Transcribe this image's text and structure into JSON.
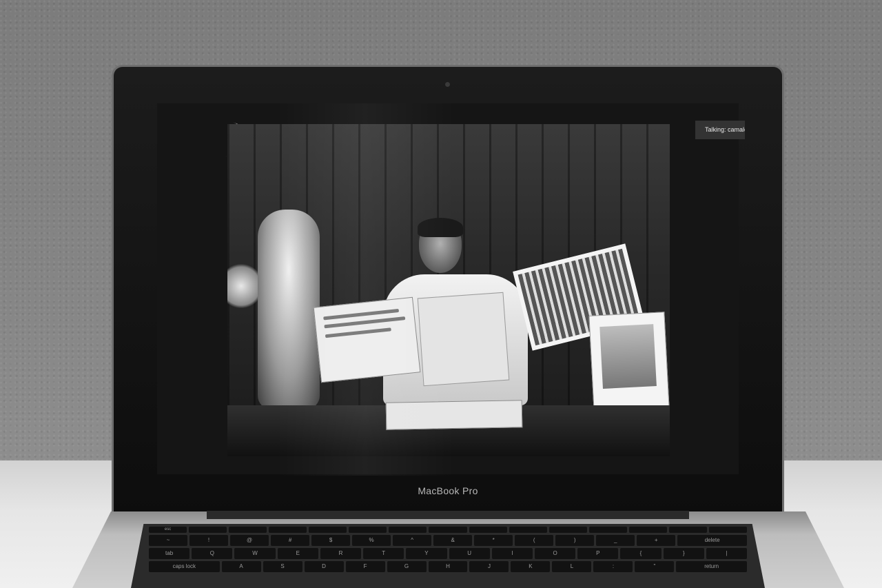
{
  "laptop": {
    "brand_label": "MacBook Pro"
  },
  "video_call": {
    "talking_indicator": "Talking: camale"
  },
  "keyboard": {
    "function_row": [
      "esc",
      "",
      "",
      "",
      "",
      "",
      "",
      "",
      "",
      "",
      "",
      "",
      "",
      "",
      ""
    ],
    "number_row": [
      "~",
      "!",
      "@",
      "#",
      "$",
      "%",
      "^",
      "&",
      "*",
      "(",
      ")",
      "_",
      "+",
      "delete"
    ],
    "qwerty_row": [
      "tab",
      "Q",
      "W",
      "E",
      "R",
      "T",
      "Y",
      "U",
      "I",
      "O",
      "P",
      "{",
      "}",
      "|"
    ],
    "home_row": [
      "caps lock",
      "A",
      "S",
      "D",
      "F",
      "G",
      "H",
      "J",
      "K",
      "L",
      ":",
      "\"",
      "return"
    ]
  }
}
